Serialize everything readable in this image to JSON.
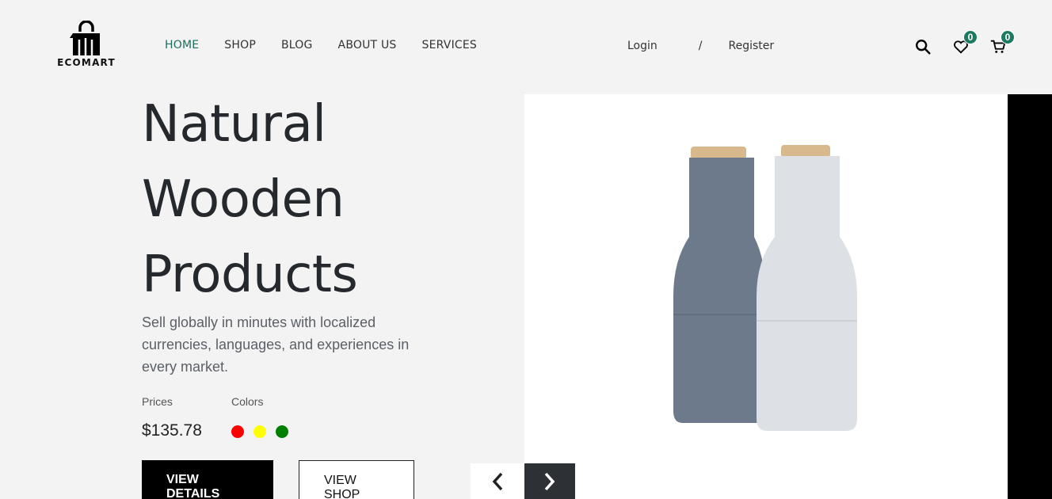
{
  "brand": {
    "name": "ECOMART"
  },
  "nav": {
    "items": [
      {
        "label": "HOME",
        "active": true
      },
      {
        "label": "SHOP"
      },
      {
        "label": "BLOG"
      },
      {
        "label": "ABOUT US"
      },
      {
        "label": "SERVICES"
      }
    ]
  },
  "auth": {
    "login": "Login",
    "separator": "/",
    "register": "Register"
  },
  "header_icons": {
    "search": "search-icon",
    "wishlist": "heart-icon",
    "cart": "cart-icon",
    "wishlist_count": "0",
    "cart_count": "0"
  },
  "hero": {
    "title_line1": "Natural",
    "title_line2": "Wooden",
    "title_line3": "Products",
    "description": "Sell globally in minutes with localized currencies, languages, and experiences in every market.",
    "prices_label": "Prices",
    "colors_label": "Colors",
    "price": "$135.78",
    "colors": [
      "#ff0000",
      "#ffff00",
      "#008000"
    ],
    "view_details": "VIEW DETAILS",
    "view_shop": "VIEW SHOP"
  },
  "slider": {
    "prev_icon": "chevron-left-icon",
    "next_icon": "chevron-right-icon"
  },
  "theme": {
    "accent": "#1f6d5b",
    "badge": "#1b7a60",
    "bg": "#f3f3f3"
  }
}
